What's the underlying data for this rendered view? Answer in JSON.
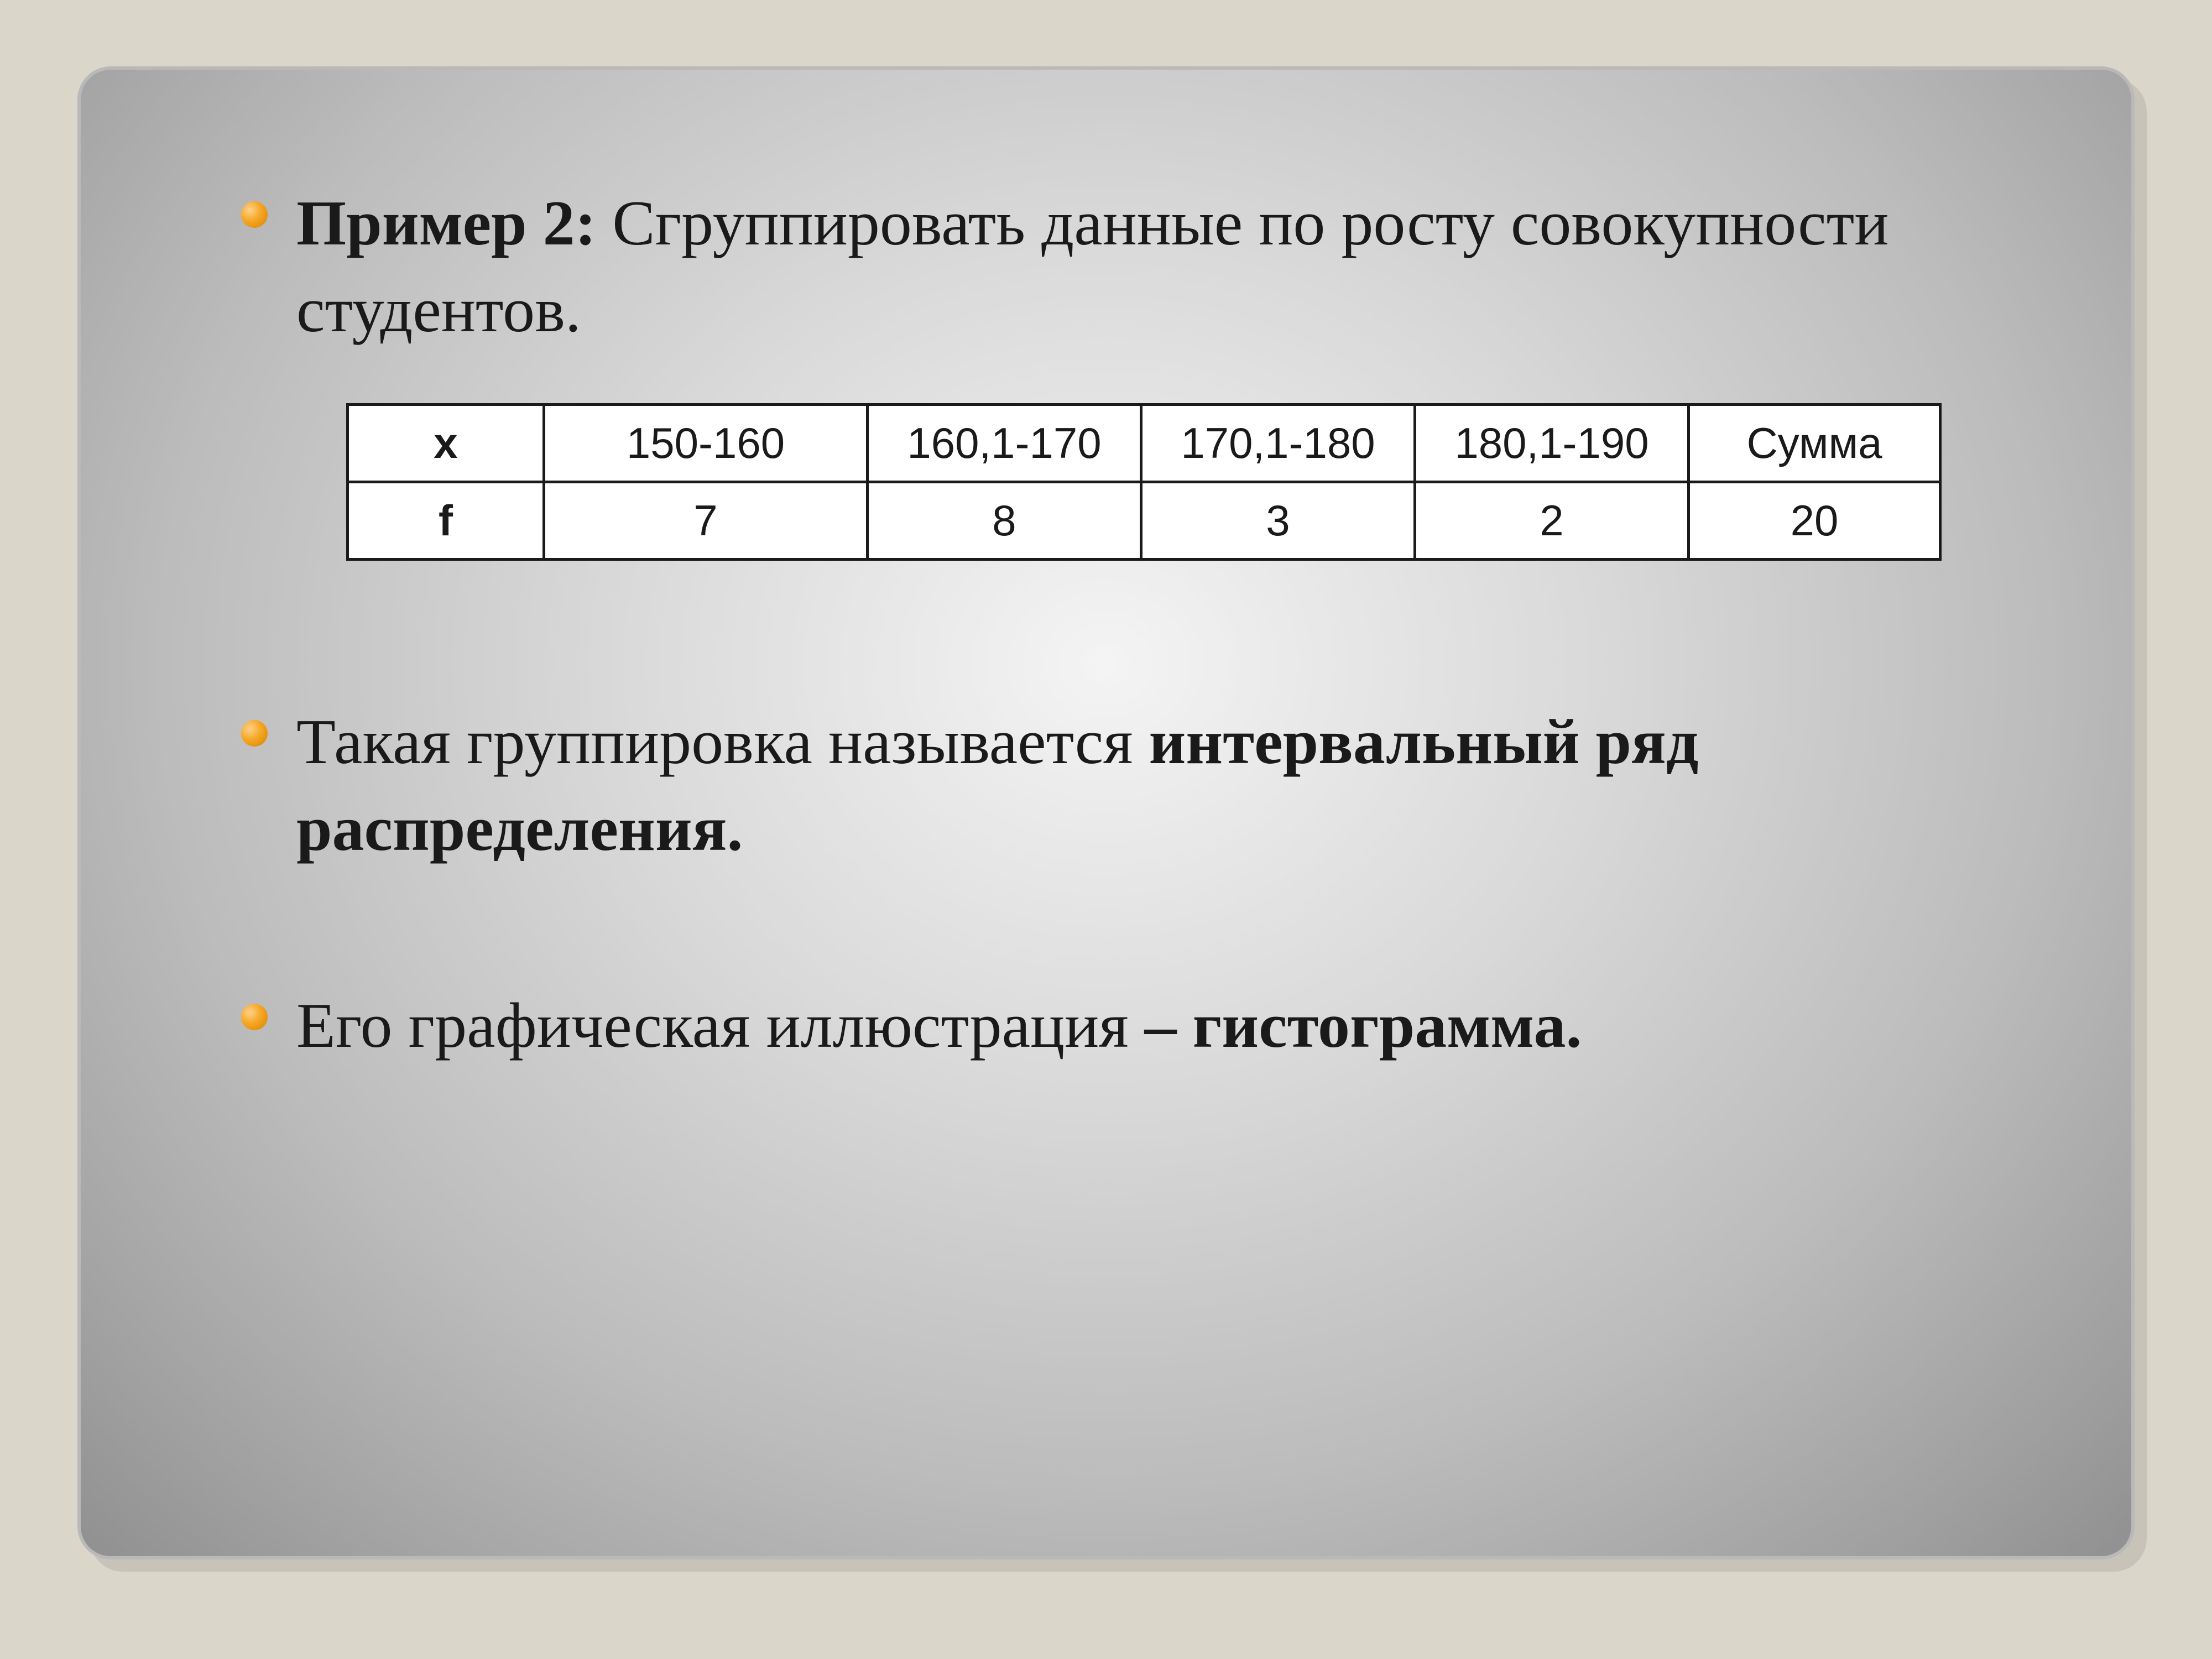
{
  "bullets": {
    "b1": {
      "prefix": "Пример 2:",
      "rest": "  Сгруппировать данные по росту совокупности студентов."
    },
    "b2": {
      "pre": "Такая группировка называется ",
      "bold": "интервальный ряд распределения."
    },
    "b3": {
      "pre": "Его графическая иллюстрация",
      "bold": " – гистограмма."
    }
  },
  "table": {
    "row_x_label": "x",
    "row_f_label": "f",
    "cols": [
      "150-160",
      "160,1-170",
      "170,1-180",
      "180,1-190",
      "Сумма"
    ],
    "f": [
      "7",
      "8",
      "3",
      "2",
      "20"
    ]
  },
  "chart_data": {
    "type": "table",
    "title": "Пример 2: Сгруппировать данные по росту совокупности студентов.",
    "columns": [
      "x",
      "150-160",
      "160,1-170",
      "170,1-180",
      "180,1-190",
      "Сумма"
    ],
    "rows": [
      {
        "label": "f",
        "values": [
          7,
          8,
          3,
          2,
          20
        ]
      }
    ],
    "notes": [
      "Такая группировка называется интервальный ряд распределения.",
      "Его графическая иллюстрация – гистограмма."
    ]
  }
}
